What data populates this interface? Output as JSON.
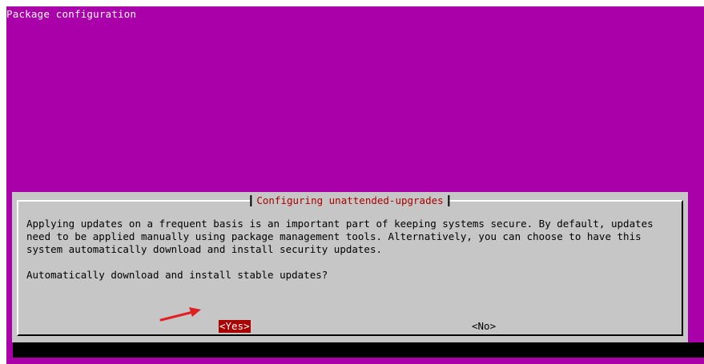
{
  "window": {
    "header_title": "Package configuration"
  },
  "dialog": {
    "title": "Configuring unattended-upgrades",
    "paragraph": "Applying updates on a frequent basis is an important part of keeping systems secure. By default, updates need to be applied manually using package management tools. Alternatively, you can choose to have this system automatically download and install security updates.",
    "question": "Automatically download and install stable updates?",
    "buttons": {
      "yes": "<Yes>",
      "no": "<No>"
    }
  },
  "colors": {
    "background": "#aa00aa",
    "dialog": "#c6c6c6",
    "title": "#aa0000",
    "selected_button": "#aa0000",
    "annotation_arrow": "#e02020"
  },
  "annotation": {
    "arrow_icon": "red-arrow-icon"
  }
}
